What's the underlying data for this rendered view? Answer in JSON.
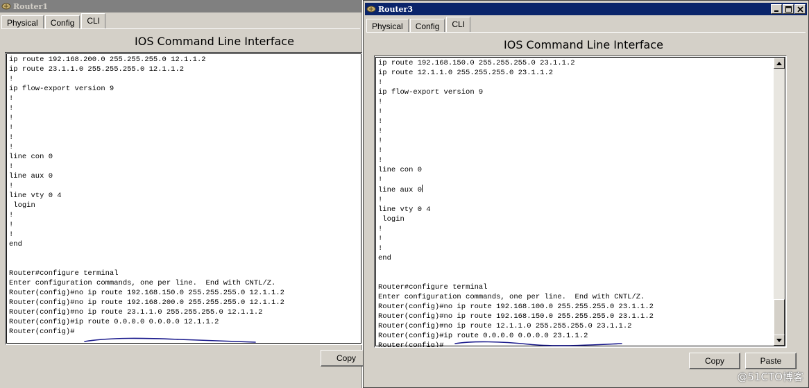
{
  "colors": {
    "inactive_titlebar": "#808080",
    "active_titlebar": "#0a246a",
    "window_face": "#d4d0c8",
    "terminal_bg": "#ffffff",
    "ink_underline": "#1a1a8c"
  },
  "router1": {
    "title": "Router1",
    "tabs": [
      "Physical",
      "Config",
      "CLI"
    ],
    "active_tab": "CLI",
    "heading": "IOS Command Line Interface",
    "copy_label": "Copy",
    "lines": [
      "ip route 192.168.200.0 255.255.255.0 12.1.1.2",
      "ip route 23.1.1.0 255.255.255.0 12.1.1.2",
      "!",
      "ip flow-export version 9",
      "!",
      "!",
      "!",
      "!",
      "!",
      "!",
      "line con 0",
      "!",
      "line aux 0",
      "!",
      "line vty 0 4",
      " login",
      "!",
      "!",
      "!",
      "end",
      "",
      "",
      "Router#configure terminal",
      "Enter configuration commands, one per line.  End with CNTL/Z.",
      "Router(config)#no ip route 192.168.150.0 255.255.255.0 12.1.1.2",
      "Router(config)#no ip route 192.168.200.0 255.255.255.0 12.1.1.2",
      "Router(config)#no ip route 23.1.1.0 255.255.255.0 12.1.1.2",
      "Router(config)#ip route 0.0.0.0 0.0.0.0 12.1.1.2",
      "Router(config)#"
    ]
  },
  "router3": {
    "title": "Router3",
    "tabs": [
      "Physical",
      "Config",
      "CLI"
    ],
    "active_tab": "CLI",
    "heading": "IOS Command Line Interface",
    "copy_label": "Copy",
    "paste_label": "Paste",
    "lines": [
      "ip route 192.168.150.0 255.255.255.0 23.1.1.2",
      "ip route 12.1.1.0 255.255.255.0 23.1.1.2",
      "!",
      "ip flow-export version 9",
      "!",
      "!",
      "!",
      "!",
      "!",
      "!",
      "!",
      "line con 0",
      "!",
      "line aux 0",
      "!",
      "line vty 0 4",
      " login",
      "!",
      "!",
      "!",
      "end",
      "",
      "",
      "Router#configure terminal",
      "Enter configuration commands, one per line.  End with CNTL/Z.",
      "Router(config)#no ip route 192.168.100.0 255.255.255.0 23.1.1.2",
      "Router(config)#no ip route 192.168.150.0 255.255.255.0 23.1.1.2",
      "Router(config)#no ip route 12.1.1.0 255.255.255.0 23.1.1.2",
      "Router(config)#ip route 0.0.0.0 0.0.0.0 23.1.1.2",
      "Router(config)#"
    ]
  },
  "watermark": "@51CTO博客"
}
